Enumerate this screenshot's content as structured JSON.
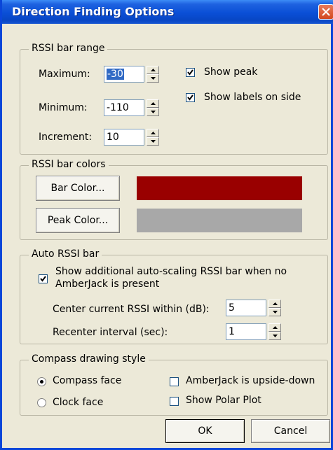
{
  "window": {
    "title": "Direction Finding Options"
  },
  "rssi_range": {
    "group_label": "RSSI bar range",
    "maximum_label": "Maximum:",
    "maximum_value": "-30",
    "minimum_label": "Minimum:",
    "minimum_value": "-110",
    "increment_label": "Increment:",
    "increment_value": "10",
    "show_peak_label": "Show peak",
    "show_peak_checked": true,
    "show_labels_label": "Show labels on side",
    "show_labels_checked": true
  },
  "rssi_colors": {
    "group_label": "RSSI bar colors",
    "bar_color_button": "Bar Color...",
    "bar_color": "#990000",
    "peak_color_button": "Peak Color...",
    "peak_color": "#a8a8a8"
  },
  "auto_rssi": {
    "group_label": "Auto RSSI bar",
    "show_auto_line1": "Show additional auto-scaling RSSI bar when no",
    "show_auto_line2": "AmberJack is present",
    "show_auto_checked": true,
    "center_label": "Center current RSSI within (dB):",
    "center_value": "5",
    "recenter_label": "Recenter interval (sec):",
    "recenter_value": "1"
  },
  "compass": {
    "group_label": "Compass drawing style",
    "compass_face_label": "Compass face",
    "compass_face_selected": true,
    "clock_face_label": "Clock face",
    "clock_face_selected": false,
    "upside_down_label": "AmberJack is upside-down",
    "upside_down_checked": false,
    "polar_plot_label": "Show Polar Plot",
    "polar_plot_checked": false
  },
  "footer": {
    "ok_label": "OK",
    "cancel_label": "Cancel"
  }
}
